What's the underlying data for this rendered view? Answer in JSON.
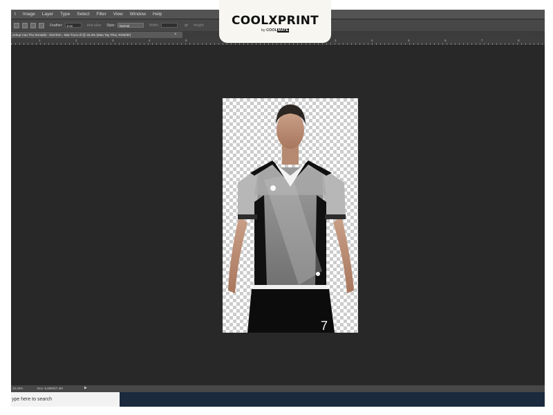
{
  "menu": [
    "t",
    "Image",
    "Layer",
    "Type",
    "Select",
    "Filter",
    "View",
    "Window",
    "Help"
  ],
  "options": {
    "feather_label": "Feather:",
    "feather_value": "0 px",
    "antialias_label": "Anti-alias",
    "style_label": "Style:",
    "style_value": "Normal",
    "width_label": "Width:",
    "height_label": "Height:"
  },
  "document_tab": {
    "title": "ockup Cau Thu Ronaldo - DonTom - Mat Truoc.tif @ 33,3% (Mau Tay Phai, RGB/8#)",
    "close": "×"
  },
  "ruler_numbers": [
    "0",
    "1",
    "2",
    "3",
    "4",
    "5",
    "6",
    "7",
    "8",
    "3",
    "4",
    "5",
    "6",
    "7",
    "8"
  ],
  "status": {
    "zoom": "33,33%",
    "doc": "Doc: 6,83M/27,4M",
    "arrow": "▶"
  },
  "taskbar": {
    "search_placeholder": "ype here to search"
  },
  "logo": {
    "main": "COOLXPRINT",
    "by": "by",
    "sub_brand": "COOL",
    "sub_box": "MATE"
  },
  "jersey": {
    "number": "7"
  },
  "colors": {
    "workspace": "#282828",
    "menubar": "#535353",
    "taskbar": "#1b2a3d",
    "logo_bg": "#f7f6f1"
  }
}
